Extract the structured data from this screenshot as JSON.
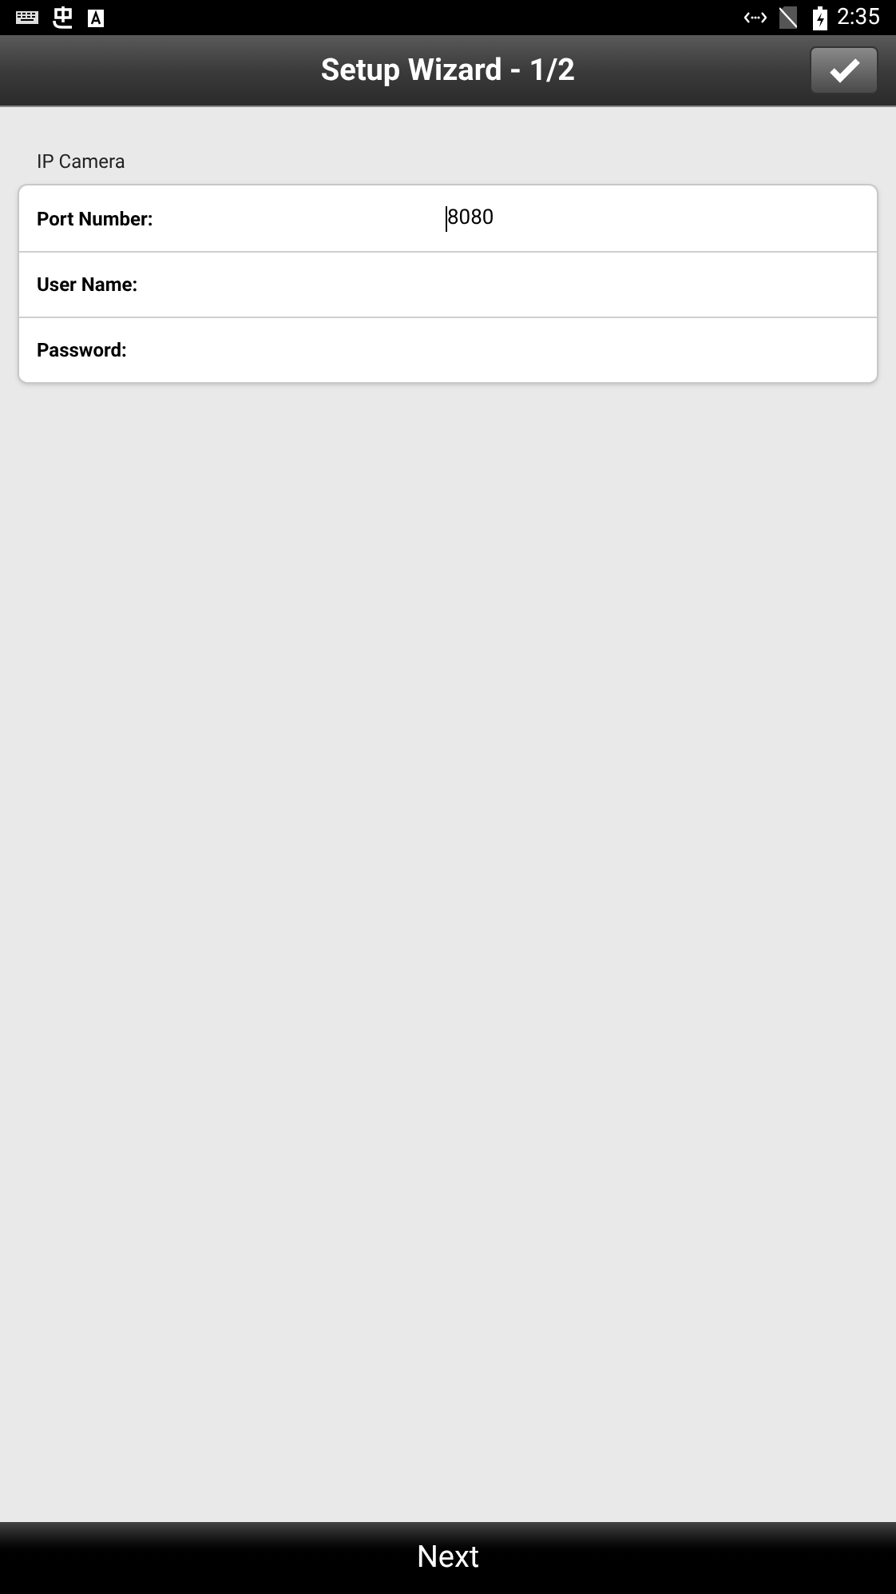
{
  "status_bar": {
    "time": "2:35"
  },
  "header": {
    "title": "Setup Wizard - 1/2"
  },
  "section": {
    "title": "IP Camera",
    "fields": [
      {
        "label": "Port Number:",
        "value": "8080",
        "focused": true
      },
      {
        "label": "User Name:",
        "focused": false
      },
      {
        "label": "Password:",
        "focused": false
      }
    ]
  },
  "footer": {
    "next_label": "Next"
  }
}
